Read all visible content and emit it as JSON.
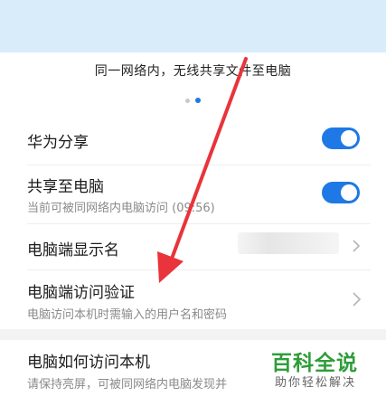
{
  "banner": {
    "caption": "同一网络内，无线共享文件至电脑"
  },
  "pager": {
    "active_index": 2,
    "count": 2
  },
  "settings": {
    "huawei_share": {
      "title": "华为分享",
      "enabled": true
    },
    "share_to_pc": {
      "title": "共享至电脑",
      "subtitle": "当前可被同网络内电脑访问 (09:56)",
      "enabled": true
    },
    "pc_display_name": {
      "title": "电脑端显示名"
    },
    "pc_access_verify": {
      "title": "电脑端访问验证",
      "subtitle": "电脑访问本机时需输入的用户名和密码"
    },
    "how_pc_access": {
      "title": "电脑如何访问本机",
      "subtitle": "请保持亮屏，可被同网络内电脑发现并"
    }
  },
  "watermark": {
    "title": "百科全说",
    "subtitle": "助你轻松解决"
  },
  "colors": {
    "accent": "#1e78e6",
    "arrow": "#e8343a",
    "watermark": "#2e9d3a"
  }
}
